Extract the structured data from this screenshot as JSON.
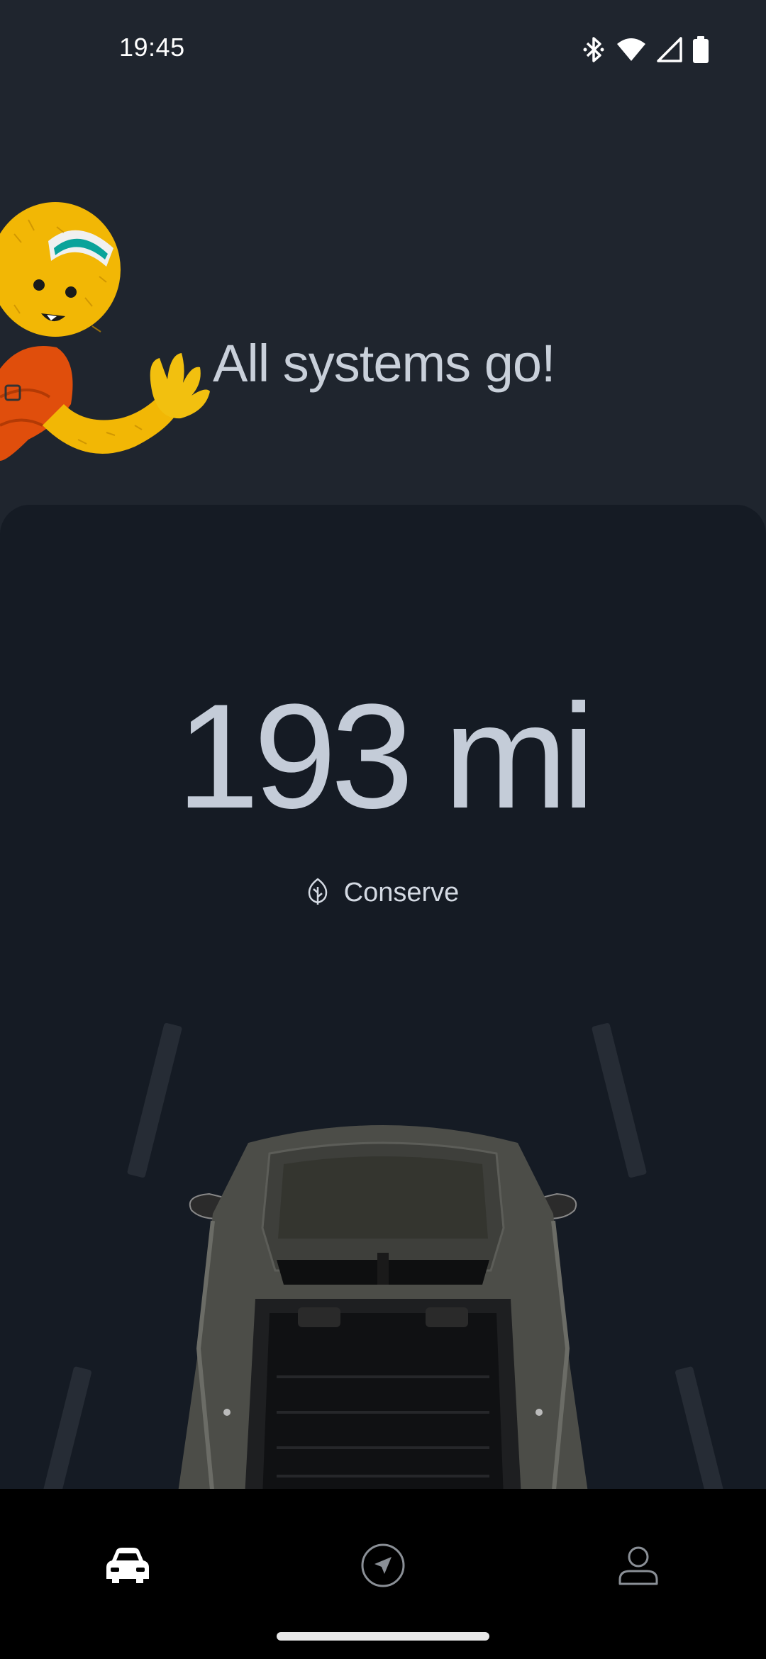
{
  "status_bar": {
    "time": "19:45",
    "icons": [
      "bluetooth-icon",
      "wifi-icon",
      "cellular-signal-icon",
      "battery-icon"
    ]
  },
  "hero": {
    "headline": "All systems go!",
    "mascot": "waving-yellow-yeti-illustration"
  },
  "vehicle": {
    "range": "193 mi",
    "drive_mode": "Conserve",
    "drive_mode_icon": "leaf-icon"
  },
  "bottom_nav": {
    "items": [
      {
        "icon": "vehicle-icon",
        "active": true
      },
      {
        "icon": "navigation-icon",
        "active": false
      },
      {
        "icon": "profile-icon",
        "active": false
      }
    ]
  },
  "colors": {
    "background": "#1f252e",
    "card": "#151b24",
    "text_primary": "#c4ccd8",
    "nav_background": "#000000"
  }
}
